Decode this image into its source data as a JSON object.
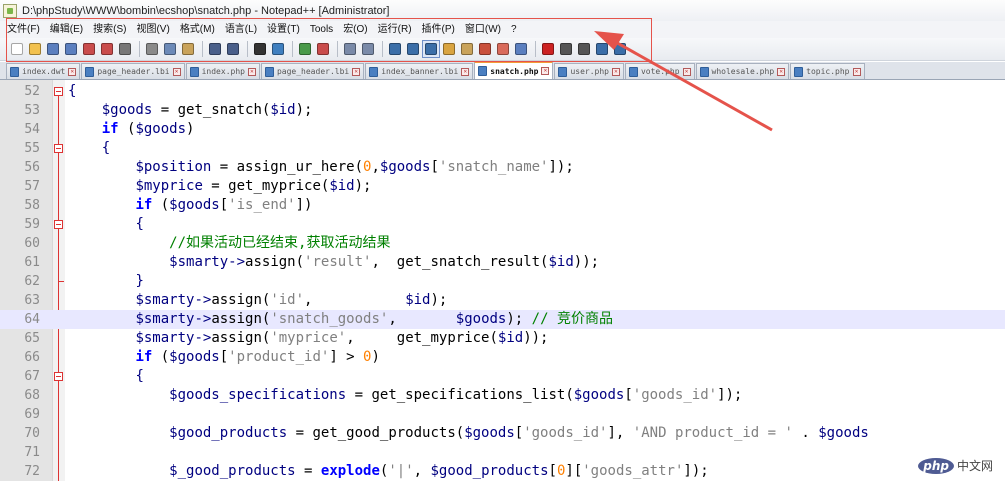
{
  "window": {
    "title": "D:\\phpStudy\\WWW\\bombin\\ecshop\\snatch.php - Notepad++ [Administrator]"
  },
  "menu": [
    "文件(F)",
    "编辑(E)",
    "搜索(S)",
    "视图(V)",
    "格式(M)",
    "语言(L)",
    "设置(T)",
    "Tools",
    "宏(O)",
    "运行(R)",
    "插件(P)",
    "窗口(W)",
    "?"
  ],
  "toolbar_icons": [
    {
      "name": "new-file-icon",
      "color": "#ffffff"
    },
    {
      "name": "open-file-icon",
      "color": "#f2c14e"
    },
    {
      "name": "save-icon",
      "color": "#5b7fbf"
    },
    {
      "name": "save-all-icon",
      "color": "#5b7fbf"
    },
    {
      "name": "close-icon",
      "color": "#c94c4c"
    },
    {
      "name": "close-all-icon",
      "color": "#c94c4c"
    },
    {
      "name": "print-icon",
      "color": "#777777"
    },
    {
      "sep": true
    },
    {
      "name": "cut-icon",
      "color": "#8a8a8a"
    },
    {
      "name": "copy-icon",
      "color": "#6c8ab8"
    },
    {
      "name": "paste-icon",
      "color": "#c9a35b"
    },
    {
      "sep": true
    },
    {
      "name": "undo-icon",
      "color": "#4a5f8a"
    },
    {
      "name": "redo-icon",
      "color": "#4a5f8a"
    },
    {
      "sep": true
    },
    {
      "name": "find-icon",
      "color": "#333333"
    },
    {
      "name": "replace-icon",
      "color": "#3f7fbf"
    },
    {
      "sep": true
    },
    {
      "name": "zoom-in-icon",
      "color": "#4a9a4a"
    },
    {
      "name": "zoom-out-icon",
      "color": "#c94c4c"
    },
    {
      "sep": true
    },
    {
      "name": "sync-vertical-icon",
      "color": "#7a8aa8"
    },
    {
      "name": "sync-horizontal-icon",
      "color": "#7a8aa8"
    },
    {
      "sep": true
    },
    {
      "name": "word-wrap-icon",
      "color": "#3b6ea8"
    },
    {
      "name": "show-all-chars-icon",
      "color": "#3b6ea8"
    },
    {
      "name": "indent-guide-icon",
      "color": "#3b6ea8",
      "active": true
    },
    {
      "name": "lang-udl-icon",
      "color": "#d9a441"
    },
    {
      "name": "document-map-icon",
      "color": "#c9a35b"
    },
    {
      "name": "function-list-icon",
      "color": "#c9503c"
    },
    {
      "name": "folder-as-workspace-icon",
      "color": "#d96a5b"
    },
    {
      "name": "monitoring-icon",
      "color": "#5b7fbf"
    },
    {
      "sep": true
    },
    {
      "name": "record-macro-icon",
      "color": "#cc2222"
    },
    {
      "name": "stop-record-icon",
      "color": "#555555"
    },
    {
      "name": "playback-macro-icon",
      "color": "#555555"
    },
    {
      "name": "run-macro-multiple-icon",
      "color": "#3b6ea8"
    },
    {
      "name": "save-macro-icon",
      "color": "#3b6ea8"
    }
  ],
  "tabs": [
    {
      "label": "index.dwt",
      "active": false
    },
    {
      "label": "page_header.lbi",
      "active": false
    },
    {
      "label": "index.php",
      "active": false
    },
    {
      "label": "page_header.lbi",
      "active": false
    },
    {
      "label": "index_banner.lbi",
      "active": false
    },
    {
      "label": "snatch.php",
      "active": true
    },
    {
      "label": "user.php",
      "active": false
    },
    {
      "label": "vote.php",
      "active": false
    },
    {
      "label": "wholesale.php",
      "active": false
    },
    {
      "label": "topic.php",
      "active": false
    }
  ],
  "current_line": 64,
  "lines": [
    {
      "n": "52",
      "fold": "open",
      "segs": [
        [
          "op",
          "{"
        ]
      ]
    },
    {
      "n": "53",
      "segs": [
        [
          "def",
          "    "
        ],
        [
          "var",
          "$goods"
        ],
        [
          "def",
          " = get_snatch("
        ],
        [
          "var",
          "$id"
        ],
        [
          "def",
          ");"
        ]
      ]
    },
    {
      "n": "54",
      "segs": [
        [
          "def",
          "    "
        ],
        [
          "kw",
          "if"
        ],
        [
          "def",
          " ("
        ],
        [
          "var",
          "$goods"
        ],
        [
          "def",
          ")"
        ]
      ]
    },
    {
      "n": "55",
      "fold": "open",
      "segs": [
        [
          "def",
          "    "
        ],
        [
          "op",
          "{"
        ]
      ]
    },
    {
      "n": "56",
      "segs": [
        [
          "def",
          "        "
        ],
        [
          "var",
          "$position"
        ],
        [
          "def",
          " = assign_ur_here("
        ],
        [
          "num",
          "0"
        ],
        [
          "def",
          ","
        ],
        [
          "var",
          "$goods"
        ],
        [
          "def",
          "["
        ],
        [
          "str",
          "'snatch_name'"
        ],
        [
          "def",
          "]);"
        ]
      ]
    },
    {
      "n": "57",
      "segs": [
        [
          "def",
          "        "
        ],
        [
          "var",
          "$myprice"
        ],
        [
          "def",
          " = get_myprice("
        ],
        [
          "var",
          "$id"
        ],
        [
          "def",
          ");"
        ]
      ]
    },
    {
      "n": "58",
      "segs": [
        [
          "def",
          "        "
        ],
        [
          "kw",
          "if"
        ],
        [
          "def",
          " ("
        ],
        [
          "var",
          "$goods"
        ],
        [
          "def",
          "["
        ],
        [
          "str",
          "'is_end'"
        ],
        [
          "def",
          "])"
        ]
      ]
    },
    {
      "n": "59",
      "fold": "open",
      "segs": [
        [
          "def",
          "        "
        ],
        [
          "op",
          "{"
        ]
      ]
    },
    {
      "n": "60",
      "segs": [
        [
          "def",
          "            "
        ],
        [
          "cm",
          "//如果活动已经结束,获取活动结果"
        ]
      ]
    },
    {
      "n": "61",
      "segs": [
        [
          "def",
          "            "
        ],
        [
          "var",
          "$smarty"
        ],
        [
          "op",
          "->"
        ],
        [
          "def",
          "assign("
        ],
        [
          "str",
          "'result'"
        ],
        [
          "def",
          ",  get_snatch_result("
        ],
        [
          "var",
          "$id"
        ],
        [
          "def",
          "));"
        ]
      ]
    },
    {
      "n": "62",
      "fold": "end",
      "segs": [
        [
          "def",
          "        "
        ],
        [
          "op",
          "}"
        ]
      ]
    },
    {
      "n": "63",
      "segs": [
        [
          "def",
          "        "
        ],
        [
          "var",
          "$smarty"
        ],
        [
          "op",
          "->"
        ],
        [
          "def",
          "assign("
        ],
        [
          "str",
          "'id'"
        ],
        [
          "def",
          ",           "
        ],
        [
          "var",
          "$id"
        ],
        [
          "def",
          ");"
        ]
      ]
    },
    {
      "n": "64",
      "segs": [
        [
          "def",
          "        "
        ],
        [
          "var",
          "$smarty"
        ],
        [
          "op",
          "->"
        ],
        [
          "def",
          "assign("
        ],
        [
          "str",
          "'snatch_goods'"
        ],
        [
          "def",
          ",       "
        ],
        [
          "var",
          "$goods"
        ],
        [
          "def",
          "); "
        ],
        [
          "cm",
          "// 竞价商品"
        ]
      ]
    },
    {
      "n": "65",
      "segs": [
        [
          "def",
          "        "
        ],
        [
          "var",
          "$smarty"
        ],
        [
          "op",
          "->"
        ],
        [
          "def",
          "assign("
        ],
        [
          "str",
          "'myprice'"
        ],
        [
          "def",
          ",     get_myprice("
        ],
        [
          "var",
          "$id"
        ],
        [
          "def",
          "));"
        ]
      ]
    },
    {
      "n": "66",
      "segs": [
        [
          "def",
          "        "
        ],
        [
          "kw",
          "if"
        ],
        [
          "def",
          " ("
        ],
        [
          "var",
          "$goods"
        ],
        [
          "def",
          "["
        ],
        [
          "str",
          "'product_id'"
        ],
        [
          "def",
          "] > "
        ],
        [
          "num",
          "0"
        ],
        [
          "def",
          ")"
        ]
      ]
    },
    {
      "n": "67",
      "fold": "open",
      "segs": [
        [
          "def",
          "        "
        ],
        [
          "op",
          "{"
        ]
      ]
    },
    {
      "n": "68",
      "segs": [
        [
          "def",
          "            "
        ],
        [
          "var",
          "$goods_specifications"
        ],
        [
          "def",
          " = get_specifications_list("
        ],
        [
          "var",
          "$goods"
        ],
        [
          "def",
          "["
        ],
        [
          "str",
          "'goods_id'"
        ],
        [
          "def",
          "]);"
        ]
      ]
    },
    {
      "n": "69",
      "segs": []
    },
    {
      "n": "70",
      "segs": [
        [
          "def",
          "            "
        ],
        [
          "var",
          "$good_products"
        ],
        [
          "def",
          " = get_good_products("
        ],
        [
          "var",
          "$goods"
        ],
        [
          "def",
          "["
        ],
        [
          "str",
          "'goods_id'"
        ],
        [
          "def",
          "], "
        ],
        [
          "str",
          "'AND product_id = '"
        ],
        [
          "def",
          " . "
        ],
        [
          "var",
          "$goods"
        ]
      ]
    },
    {
      "n": "71",
      "segs": []
    },
    {
      "n": "72",
      "segs": [
        [
          "def",
          "            "
        ],
        [
          "var",
          "$_good_products"
        ],
        [
          "def",
          " = "
        ],
        [
          "kw",
          "explode"
        ],
        [
          "def",
          "("
        ],
        [
          "str",
          "'|'"
        ],
        [
          "def",
          ", "
        ],
        [
          "var",
          "$good_products"
        ],
        [
          "def",
          "["
        ],
        [
          "num",
          "0"
        ],
        [
          "def",
          "]["
        ],
        [
          "str",
          "'goods_attr'"
        ],
        [
          "def",
          "]);"
        ]
      ]
    }
  ],
  "watermark": {
    "logo": "php",
    "text": "中文网"
  }
}
